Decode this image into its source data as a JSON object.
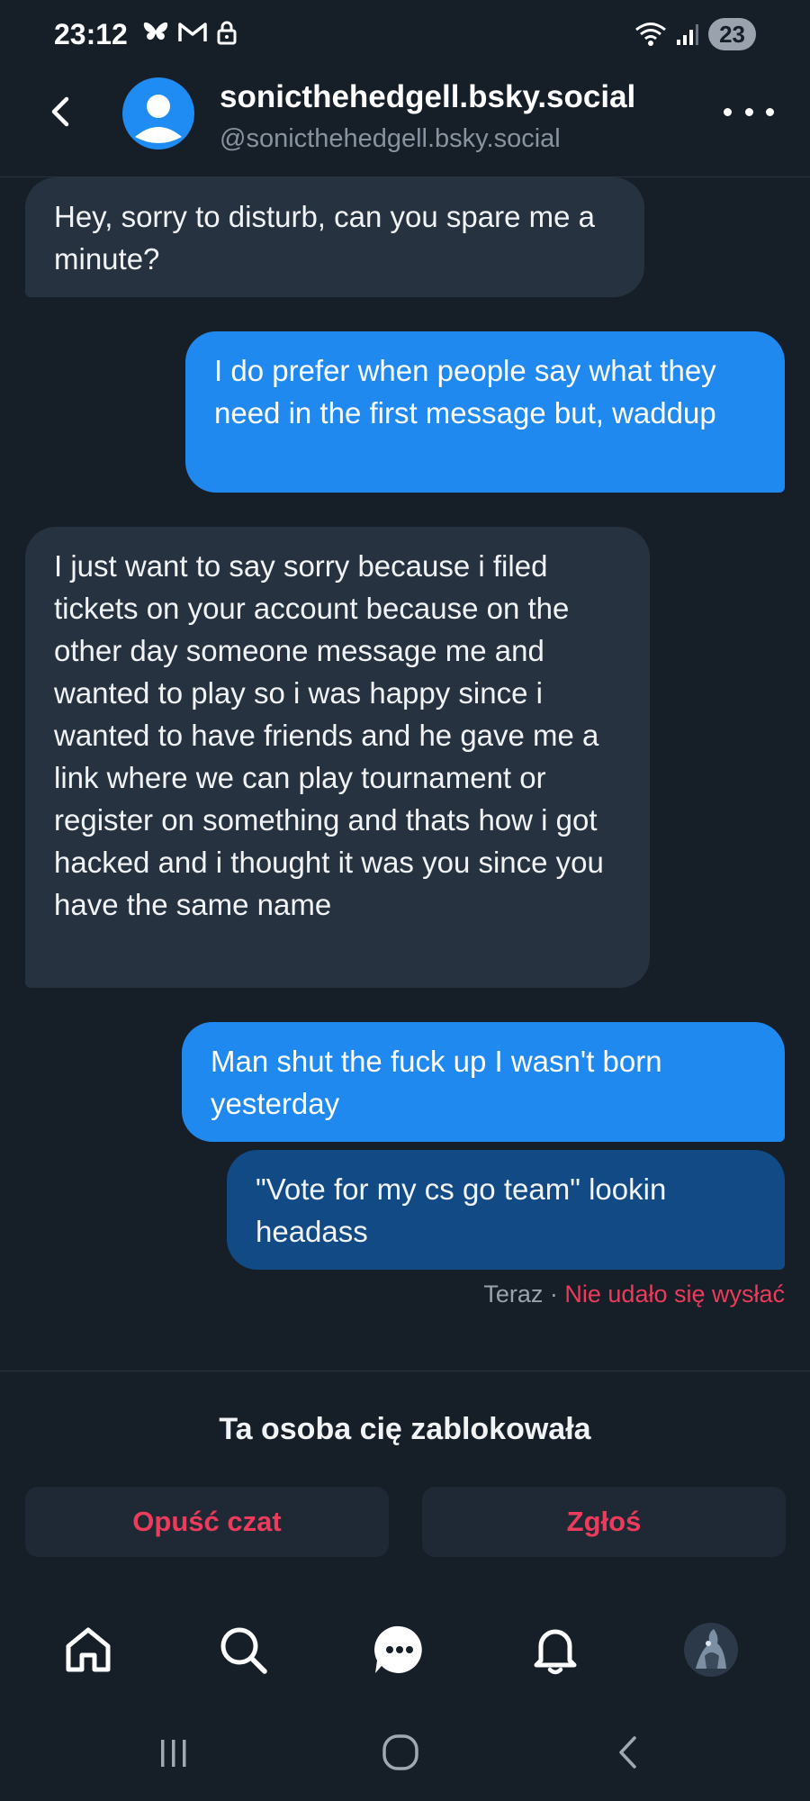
{
  "status_bar": {
    "time": "23:12",
    "battery": "23",
    "icons_left": [
      "butterfly-icon",
      "gmail-icon",
      "lock-icon"
    ],
    "icons_right": [
      "wifi-icon",
      "signal-icon"
    ]
  },
  "header": {
    "title": "sonicthehedgell.bsky.social",
    "handle": "@sonicthehedgell.bsky.social"
  },
  "messages": [
    {
      "direction": "in",
      "text": "Hey, sorry to disturb, can you spare me a minute?"
    },
    {
      "direction": "out",
      "text": "I do prefer when people say what they need in the first message but, waddup"
    },
    {
      "direction": "in",
      "text": "I just want to say sorry because i filed tickets on your account because on the other day someone message me and wanted to play so i was happy since i wanted to have friends and he gave me a link where we can play tournament or register on something and thats how i got hacked and i thought it was you since you have the same name"
    },
    {
      "direction": "out",
      "text": "Man shut the fuck up I wasn't born yesterday"
    },
    {
      "direction": "out",
      "text": "\"Vote for my cs go team\" lookin headass",
      "failed": true
    }
  ],
  "message_meta": {
    "time": "Teraz",
    "separator": " · ",
    "error": "Nie udało się wysłać"
  },
  "blocked": {
    "title": "Ta osoba cię zablokowała",
    "leave_label": "Opuść czat",
    "report_label": "Zgłoś"
  },
  "tabs": [
    "home-icon",
    "search-icon",
    "chat-icon",
    "bell-icon",
    "profile-avatar"
  ],
  "colors": {
    "background": "#161e27",
    "bubble_in": "#263240",
    "bubble_out": "#1f89f0",
    "bubble_failed": "#114a85",
    "error": "#ec3b5b"
  }
}
